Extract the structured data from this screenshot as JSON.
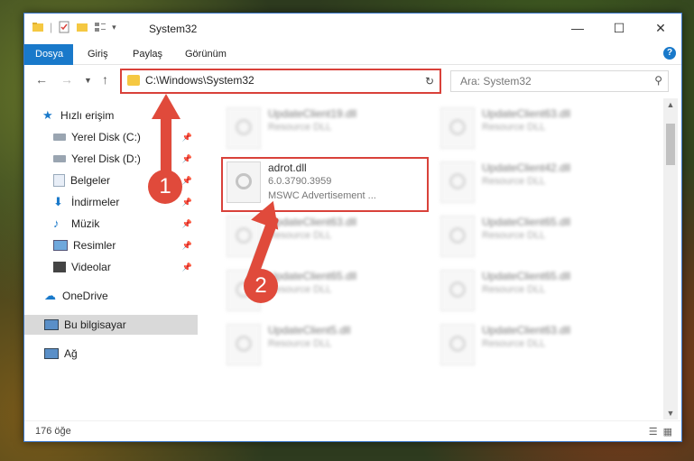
{
  "window": {
    "title": "System32"
  },
  "ribbon": {
    "tabs": [
      "Dosya",
      "Giriş",
      "Paylaş",
      "Görünüm"
    ]
  },
  "address": {
    "path": "C:\\Windows\\System32"
  },
  "search": {
    "placeholder": "Ara: System32"
  },
  "sidebar": {
    "items": [
      {
        "label": "Hızlı erişim"
      },
      {
        "label": "Yerel Disk (C:)"
      },
      {
        "label": "Yerel Disk (D:)"
      },
      {
        "label": "Belgeler"
      },
      {
        "label": "İndirmeler"
      },
      {
        "label": "Müzik"
      },
      {
        "label": "Resimler"
      },
      {
        "label": "Videolar"
      },
      {
        "label": "OneDrive"
      },
      {
        "label": "Bu bilgisayar"
      },
      {
        "label": "Ağ"
      }
    ]
  },
  "files": [
    {
      "name": "UpdateClient19.dll",
      "line1": "Resource DLL",
      "line2": ""
    },
    {
      "name": "UpdateClient63.dll",
      "line1": "Resource DLL",
      "line2": ""
    },
    {
      "name": "adrot.dll",
      "line1": "6.0.3790.3959",
      "line2": "MSWC Advertisement ..."
    },
    {
      "name": "UpdateClient42.dll",
      "line1": "Resource DLL",
      "line2": ""
    },
    {
      "name": "UpdateClient63.dll",
      "line1": "Resource DLL",
      "line2": ""
    },
    {
      "name": "UpdateClient65.dll",
      "line1": "Resource DLL",
      "line2": ""
    },
    {
      "name": "UpdateClient65.dll",
      "line1": "Resource DLL",
      "line2": ""
    },
    {
      "name": "UpdateClient65.dll",
      "line1": "Resource DLL",
      "line2": ""
    },
    {
      "name": "UpdateClient5.dll",
      "line1": "Resource DLL",
      "line2": ""
    },
    {
      "name": "UpdateClient63.dll",
      "line1": "Resource DLL",
      "line2": ""
    }
  ],
  "status": {
    "count": "176 öğe"
  },
  "annotations": {
    "step1": "1",
    "step2": "2"
  },
  "colors": {
    "accent": "#1979ca",
    "highlight": "#d9413a",
    "arrow": "#e04a3b"
  }
}
